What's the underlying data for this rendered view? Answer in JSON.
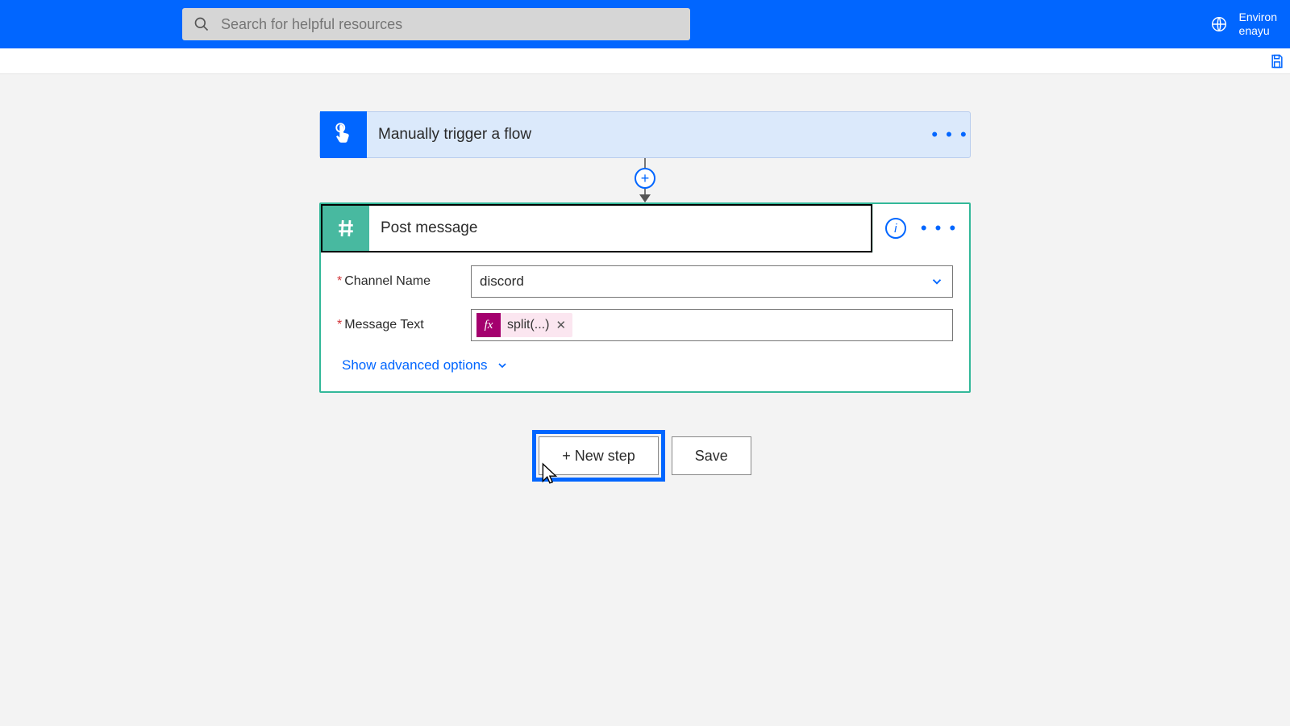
{
  "header": {
    "search_placeholder": "Search for helpful resources",
    "env_label_line1": "Environ",
    "env_label_line2": "enayu"
  },
  "trigger": {
    "title": "Manually trigger a flow"
  },
  "action": {
    "title": "Post message",
    "fields": {
      "channel_label": "Channel Name",
      "channel_value": "discord",
      "message_label": "Message Text",
      "message_token": "split(...)"
    },
    "advanced": "Show advanced options"
  },
  "buttons": {
    "new_step": "+ New step",
    "save": "Save"
  }
}
